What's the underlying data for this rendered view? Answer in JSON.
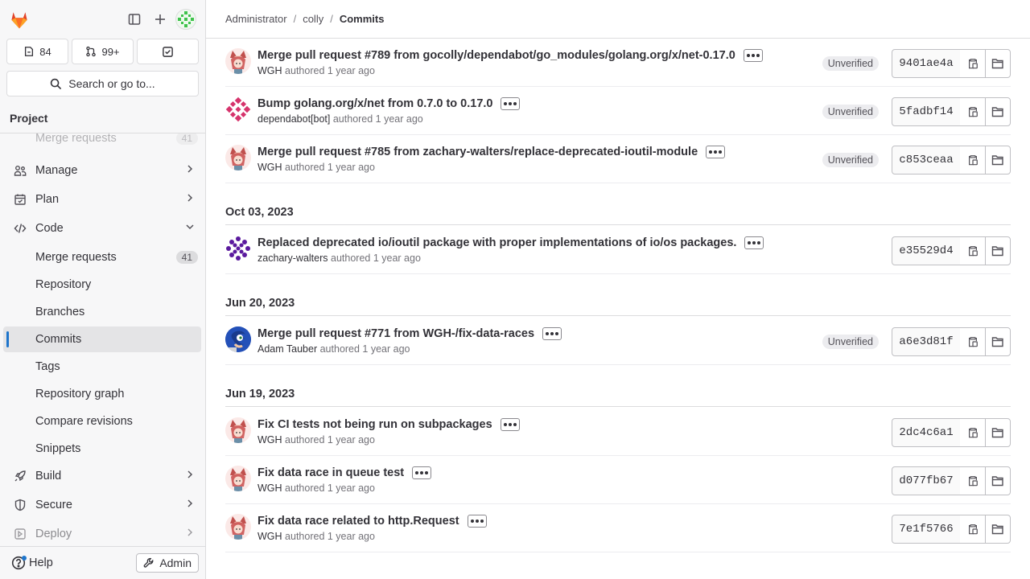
{
  "sidebar": {
    "counts": {
      "issues": "84",
      "mrs": "99+"
    },
    "search": "Search or go to...",
    "project": "Project",
    "faded_item": {
      "label": "Merge requests",
      "badge": "41"
    },
    "items": [
      {
        "label": "Manage"
      },
      {
        "label": "Plan"
      },
      {
        "label": "Code"
      },
      {
        "label": "Merge requests",
        "badge": "41"
      },
      {
        "label": "Repository"
      },
      {
        "label": "Branches"
      },
      {
        "label": "Commits"
      },
      {
        "label": "Tags"
      },
      {
        "label": "Repository graph"
      },
      {
        "label": "Compare revisions"
      },
      {
        "label": "Snippets"
      },
      {
        "label": "Build"
      },
      {
        "label": "Secure"
      },
      {
        "label": "Deploy"
      }
    ],
    "help": "Help",
    "admin": "Admin"
  },
  "breadcrumb": {
    "a": "Administrator",
    "b": "colly",
    "c": "Commits"
  },
  "groups": [
    {
      "date": "Oct 03, 2023"
    },
    {
      "date": "Jun 20, 2023"
    },
    {
      "date": "Jun 19, 2023"
    }
  ],
  "commits": [
    {
      "title": "Merge pull request #789 from gocolly/dependabot/go_modules/golang.org/x/net-0.17.0",
      "author": "WGH",
      "when": "authored 1 year ago",
      "sha": "9401ae4a",
      "status": "Unverified"
    },
    {
      "title": "Bump golang.org/x/net from 0.7.0 to 0.17.0",
      "author": "dependabot[bot]",
      "when": "authored 1 year ago",
      "sha": "5fadbf14",
      "status": "Unverified"
    },
    {
      "title": "Merge pull request #785 from zachary-walters/replace-deprecated-ioutil-module",
      "author": "WGH",
      "when": "authored 1 year ago",
      "sha": "c853ceaa",
      "status": "Unverified"
    },
    {
      "title": "Replaced deprecated io/ioutil package with proper implementations of io/os packages.",
      "author": "zachary-walters",
      "when": "authored 1 year ago",
      "sha": "e35529d4",
      "status": ""
    },
    {
      "title": "Merge pull request #771 from WGH-/fix-data-races",
      "author": "Adam Tauber",
      "when": "authored 1 year ago",
      "sha": "a6e3d81f",
      "status": "Unverified"
    },
    {
      "title": "Fix CI tests not being run on subpackages",
      "author": "WGH",
      "when": "authored 1 year ago",
      "sha": "2dc4c6a1",
      "status": ""
    },
    {
      "title": "Fix data race in queue test",
      "author": "WGH",
      "when": "authored 1 year ago",
      "sha": "d077fb67",
      "status": ""
    },
    {
      "title": "Fix data race related to http.Request",
      "author": "WGH",
      "when": "authored 1 year ago",
      "sha": "7e1f5766",
      "status": ""
    }
  ],
  "colors": {
    "accent": "#1f75cb",
    "active_bg": "#e4e4e6"
  }
}
